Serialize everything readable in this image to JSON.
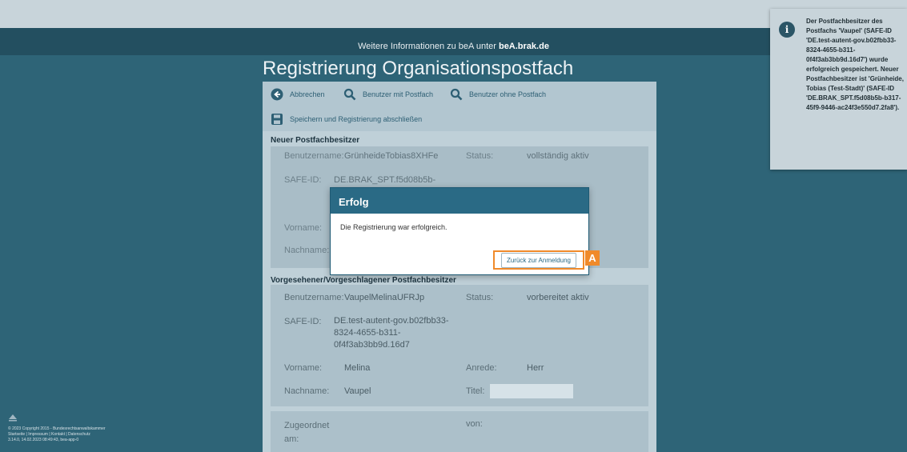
{
  "infobar": {
    "prefix": "Weitere Informationen zu beA unter",
    "link": "beA.brak.de"
  },
  "page_title": "Registrierung Organisationspostfach",
  "toolbar": {
    "cancel_label": "Abbrechen",
    "users_with_box_label": "Benutzer mit Postfach",
    "users_without_box_label": "Benutzer ohne Postfach",
    "save_label": "Speichern und Registrierung abschließen"
  },
  "new_owner": {
    "heading": "Neuer Postfachbesitzer",
    "username_label": "Benutzername:",
    "username_value": "GrünheideTobias8XHFe",
    "status_label": "Status:",
    "status_value": "vollständig aktiv",
    "safeid_label": "SAFE-ID:",
    "safeid_value": "DE.BRAK_SPT.f5d08b5b-",
    "firstname_label": "Vorname:",
    "lastname_label": "Nachname:"
  },
  "proposed_owner": {
    "heading": "Vorgesehener/Vorgeschlagener Postfachbesitzer",
    "username_label": "Benutzername:",
    "username_value": "VaupelMelinaUFRJp",
    "status_label": "Status:",
    "status_value": "vorbereitet aktiv",
    "safeid_label": "SAFE-ID:",
    "safeid_value": "DE.test-autent-gov.b02fbb33-8324-4655-b311-0f4f3ab3bb9d.16d7",
    "firstname_label": "Vorname:",
    "firstname_value": "Melina",
    "salutation_label": "Anrede:",
    "salutation_value": "Herr",
    "lastname_label": "Nachname:",
    "lastname_value": "Vaupel",
    "title_label": "Titel:",
    "assigned_label": "Zugeordnet am:",
    "from_label": "von:"
  },
  "dialog": {
    "title": "Erfolg",
    "message": "Die Registrierung war erfolgreich.",
    "button_label": "Zurück zur Anmeldung",
    "marker": "A"
  },
  "toast": {
    "message": "Der Postfachbesitzer des Postfachs 'Vaupel' (SAFE-ID 'DE.test-autent-gov.b02fbb33-8324-4655-b311-0f4f3ab3bb9d.16d7') wurde erfolgreich gespeichert. Neuer Postfachbesitzer ist 'Grünheide, Tobias (Test-Stadt)' (SAFE-ID 'DE.BRAK_SPT.f5d08b5b-b317-45f9-9446-ac24f3e550d7.2fa8')."
  },
  "footer": {
    "copyright": "© 2023 Copyright 2015 - Bundesrechtsanwaltskammer",
    "links": "Startseite | Impressum | Kontakt | Datenschutz",
    "version": "3.14.0, 14.02.2023 08:49:43, bea-app-0"
  },
  "colors": {
    "accent": "#2a6a85",
    "highlight": "#f08a2a",
    "background": "#2e6477"
  }
}
